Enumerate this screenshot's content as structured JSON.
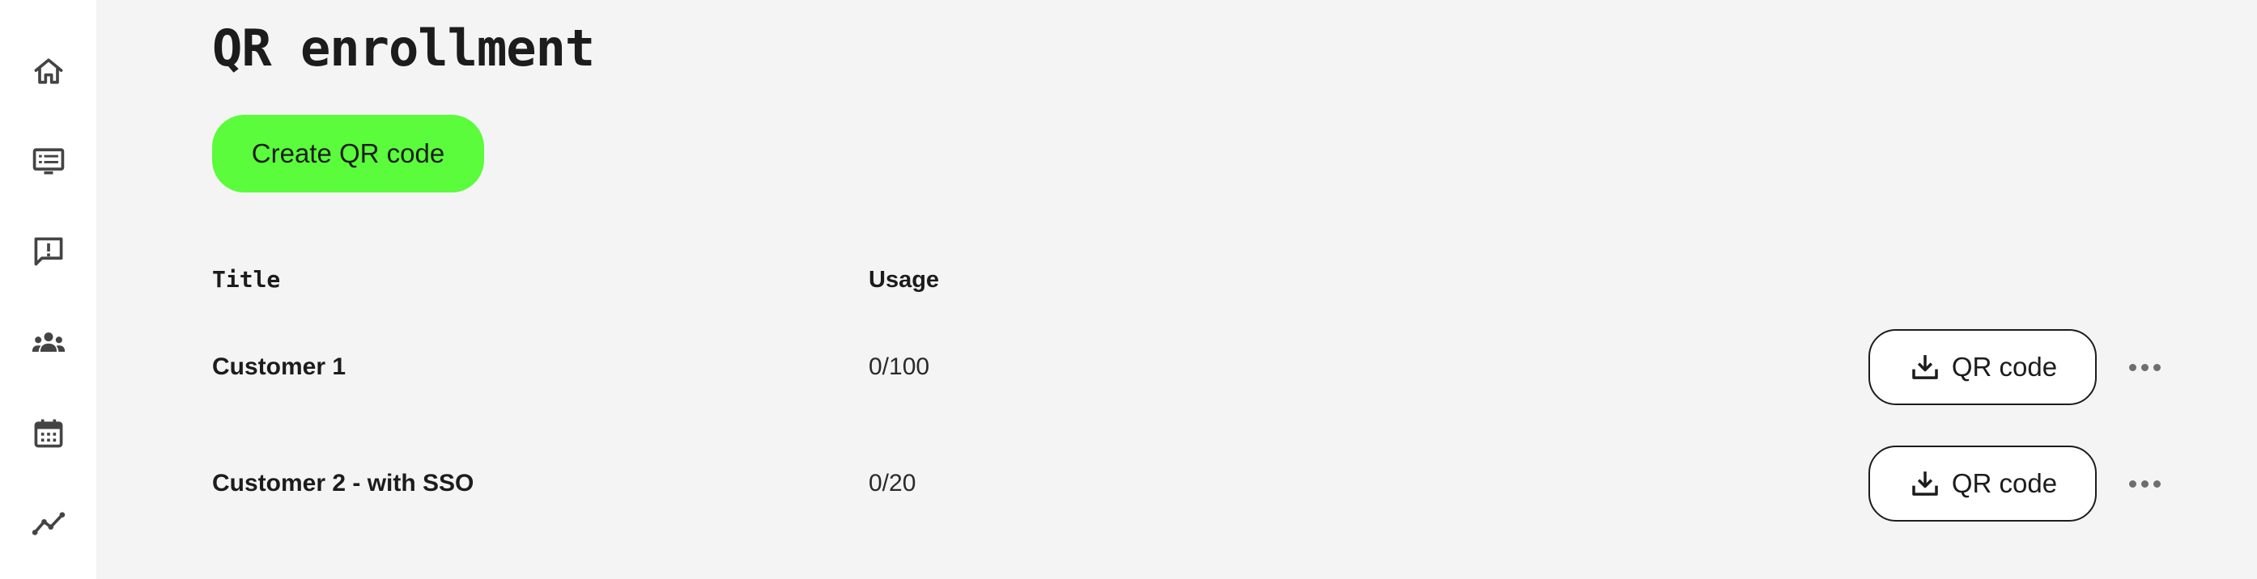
{
  "nav": {
    "items": [
      {
        "name": "home-icon"
      },
      {
        "name": "monitor-icon"
      },
      {
        "name": "report-icon"
      },
      {
        "name": "groups-icon"
      },
      {
        "name": "calendar-icon"
      },
      {
        "name": "analytics-icon"
      }
    ]
  },
  "page": {
    "title": "QR enrollment",
    "create_button_label": "Create QR code"
  },
  "colors": {
    "accent": "#5afc3b",
    "background": "#f4f4f4",
    "text": "#1c1c1c"
  },
  "table": {
    "headers": {
      "title": "Title",
      "usage": "Usage"
    },
    "rows": [
      {
        "title": "Customer 1",
        "usage": "0/100",
        "action_label": "QR code",
        "action_icon": "download-icon",
        "menu_icon": "more-icon"
      },
      {
        "title": "Customer 2 - with SSO",
        "usage": "0/20",
        "action_label": "QR code",
        "action_icon": "download-icon",
        "menu_icon": "more-icon"
      }
    ]
  }
}
